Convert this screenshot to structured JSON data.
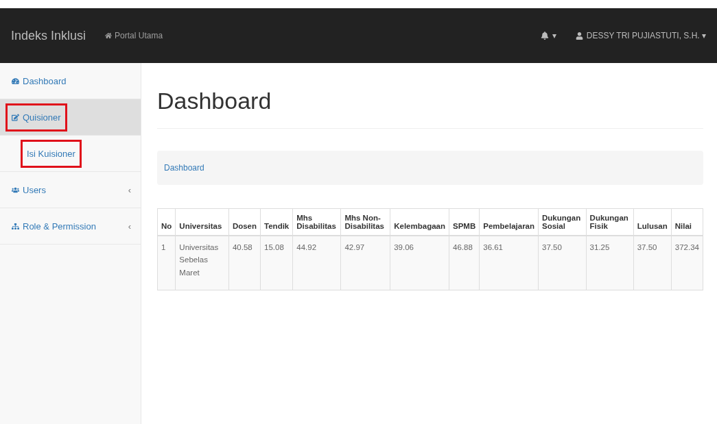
{
  "navbar": {
    "brand": "Indeks Inklusi",
    "link": "Portal Utama",
    "notification_caret": "▾",
    "user": "DESSY TRI PUJIASTUTI, S.H.",
    "user_caret": "▾"
  },
  "sidebar": {
    "items": [
      {
        "label": "Dashboard",
        "selected": false,
        "highlighted": false
      },
      {
        "label": "Quisioner",
        "selected": true,
        "highlighted": true,
        "children": [
          {
            "label": "Isi Kuisioner",
            "selected": false,
            "highlighted": true
          }
        ]
      },
      {
        "label": "Users",
        "selected": false,
        "highlighted": false,
        "chevron": "‹"
      },
      {
        "label": "Role & Permission",
        "selected": false,
        "highlighted": false,
        "chevron": "‹"
      }
    ]
  },
  "page": {
    "title": "Dashboard",
    "breadcrumb": "Dashboard"
  },
  "table": {
    "columns": [
      "No",
      "Universitas",
      "Dosen",
      "Tendik",
      "Mhs Disabilitas",
      "Mhs Non-Disabilitas",
      "Kelembagaan",
      "SPMB",
      "Pembelajaran",
      "Dukungan Sosial",
      "Dukungan Fisik",
      "Lulusan",
      "Nilai"
    ],
    "rows": [
      [
        "1",
        "Universitas Sebelas Maret",
        "40.58",
        "15.08",
        "44.92",
        "42.97",
        "39.06",
        "46.88",
        "36.61",
        "37.50",
        "31.25",
        "37.50",
        "372.34"
      ]
    ]
  }
}
